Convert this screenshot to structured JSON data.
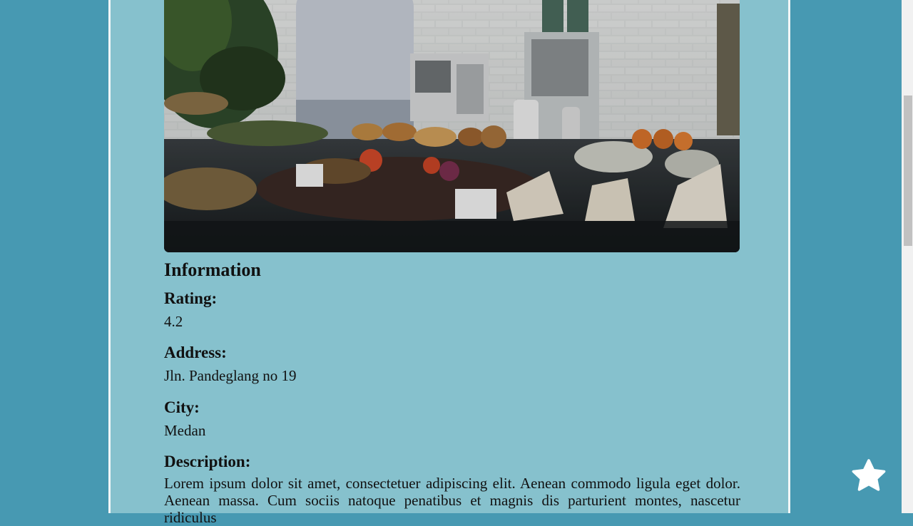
{
  "hero": {
    "image_subject": "cafe counter with chef and food display"
  },
  "information": {
    "title": "Information",
    "rating_label": "Rating:",
    "rating_value": "4.2",
    "address_label": "Address:",
    "address_value": "Jln. Pandeglang no 19",
    "city_label": "City:",
    "city_value": "Medan",
    "description_label": "Description:",
    "description_value": "Lorem ipsum dolor sit amet, consectetuer adipiscing elit. Aenean commodo ligula eget dolor. Aenean massa. Cum sociis natoque penatibus et magnis dis parturient montes, nascetur ridiculus"
  },
  "favorite": {
    "icon": "star-icon"
  },
  "colors": {
    "background": "#4799b2",
    "panel": "#86c1cd",
    "star": "#ffffff"
  }
}
